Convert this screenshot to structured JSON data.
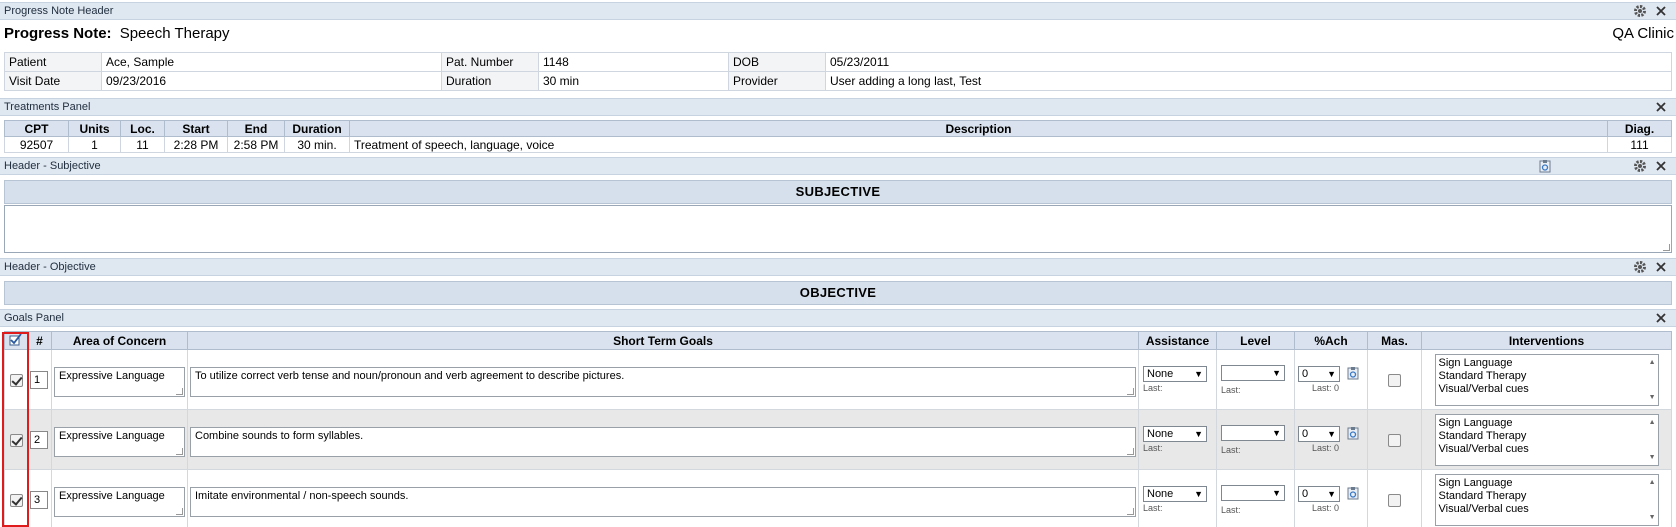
{
  "panels": {
    "progress_header": "Progress Note Header",
    "treatments": "Treatments Panel",
    "subjective_header": "Header - Subjective",
    "objective_header": "Header - Objective",
    "goals": "Goals Panel"
  },
  "note": {
    "title_label": "Progress Note:",
    "title_value": "Speech Therapy",
    "clinic": "QA Clinic"
  },
  "info": {
    "patient_label": "Patient",
    "patient": "Ace, Sample",
    "patnum_label": "Pat. Number",
    "patnum": "1148",
    "dob_label": "DOB",
    "dob": "05/23/2011",
    "visit_label": "Visit Date",
    "visit": "09/23/2016",
    "duration_label": "Duration",
    "duration": "30 min",
    "provider_label": "Provider",
    "provider": "User adding a long last, Test"
  },
  "treatments": {
    "headers": [
      "CPT",
      "Units",
      "Loc.",
      "Start",
      "End",
      "Duration",
      "Description",
      "Diag."
    ],
    "row": {
      "cpt": "92507",
      "units": "1",
      "loc": "11",
      "start": "2:28 PM",
      "end": "2:58 PM",
      "duration": "30 min.",
      "description": "Treatment of speech, language, voice",
      "diag": "111"
    }
  },
  "sections": {
    "subjective": "SUBJECTIVE",
    "objective": "OBJECTIVE"
  },
  "goals": {
    "headers": {
      "num": "#",
      "area": "Area of Concern",
      "stg": "Short Term Goals",
      "assistance": "Assistance",
      "level": "Level",
      "ach": "%Ach",
      "mas": "Mas.",
      "interventions": "Interventions"
    },
    "rows": [
      {
        "num": "1",
        "area": "Expressive Language",
        "goal": "To utilize correct verb tense and noun/pronoun and verb agreement to describe pictures.",
        "assistance": "None",
        "assist_last": "Last:",
        "level": "",
        "level_last": "Last:",
        "ach": "0",
        "ach_last": "Last: 0",
        "checked": true,
        "mastered": false,
        "interventions": [
          "Sign Language",
          "Standard Therapy",
          "Visual/Verbal cues"
        ]
      },
      {
        "num": "2",
        "area": "Expressive Language",
        "goal": "Combine sounds to form syllables.",
        "assistance": "None",
        "assist_last": "Last:",
        "level": "",
        "level_last": "Last:",
        "ach": "0",
        "ach_last": "Last: 0",
        "checked": true,
        "mastered": false,
        "interventions": [
          "Sign Language",
          "Standard Therapy",
          "Visual/Verbal cues"
        ]
      },
      {
        "num": "3",
        "area": "Expressive Language",
        "goal": "Imitate environmental / non-speech sounds.",
        "assistance": "None",
        "assist_last": "Last:",
        "level": "",
        "level_last": "Last:",
        "ach": "0",
        "ach_last": "Last: 0",
        "checked": true,
        "mastered": false,
        "interventions": [
          "Sign Language",
          "Standard Therapy",
          "Visual/Verbal cues"
        ]
      }
    ]
  },
  "icons": {
    "settings": "gear-icon",
    "close": "close-icon",
    "template": "clipboard-icon",
    "check_all": "check-all-icon"
  },
  "colors": {
    "highlight": "#e01b1b",
    "panel_bar": "#dfe7f1",
    "section_bar": "#d6e0ec"
  }
}
